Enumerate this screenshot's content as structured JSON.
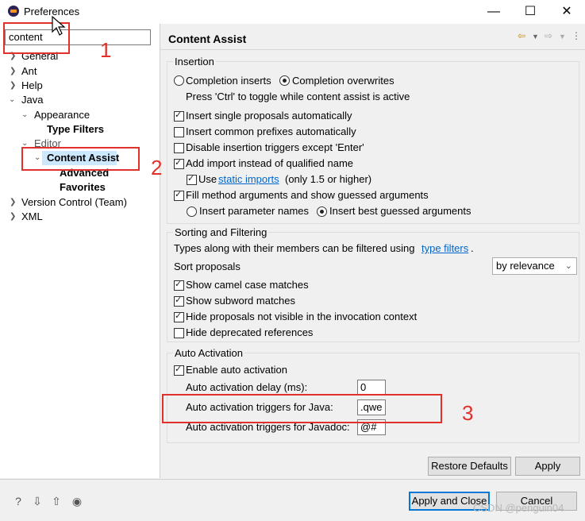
{
  "window": {
    "title": "Preferences",
    "minimize": "—",
    "maximize": "☐",
    "close": "✕"
  },
  "filter": {
    "value": "content"
  },
  "tree": {
    "general": "General",
    "ant": "Ant",
    "help": "Help",
    "java": "Java",
    "appearance": "Appearance",
    "type_filters": "Type Filters",
    "editor": "Editor",
    "content_assist": "Content Assist",
    "advanced": "Advanced",
    "favorites": "Favorites",
    "version_control": "Version Control (Team)",
    "xml": "XML"
  },
  "page": {
    "title": "Content Assist"
  },
  "insertion": {
    "title": "Insertion",
    "completion_inserts": "Completion inserts",
    "completion_overwrites": "Completion overwrites",
    "toggle_hint": "Press 'Ctrl' to toggle while content assist is active",
    "insert_single": "Insert single proposals automatically",
    "insert_common": "Insert common prefixes automatically",
    "disable_triggers": "Disable insertion triggers except 'Enter'",
    "add_import": "Add import instead of qualified name",
    "use": "Use",
    "static_imports": "static imports",
    "only_15": "(only 1.5 or higher)",
    "fill_args": "Fill method arguments and show guessed arguments",
    "insert_param": "Insert parameter names",
    "insert_best": "Insert best guessed arguments"
  },
  "sorting": {
    "title": "Sorting and Filtering",
    "types_text": "Types along with their members can be filtered using",
    "type_filters_link": "type filters",
    "period": ".",
    "sort_label": "Sort proposals",
    "sort_value": "by relevance",
    "camel": "Show camel case matches",
    "subword": "Show subword matches",
    "hide_not_visible": "Hide proposals not visible in the invocation context",
    "hide_deprecated": "Hide deprecated references"
  },
  "auto": {
    "title": "Auto Activation",
    "enable": "Enable auto activation",
    "delay_label": "Auto activation delay (ms):",
    "delay_value": "0",
    "java_label": "Auto activation triggers for Java:",
    "java_value": ".qwe",
    "javadoc_label": "Auto activation triggers for Javadoc:",
    "javadoc_value": "@#"
  },
  "buttons": {
    "restore": "Restore Defaults",
    "apply": "Apply",
    "apply_close": "Apply and Close",
    "cancel": "Cancel"
  },
  "annotations": {
    "n1": "1",
    "n2": "2",
    "n3": "3"
  },
  "watermark": "CSDN @penguin04",
  "colors": {
    "highlight": "#e0312b",
    "selection": "#cce8ff",
    "link": "#0066cc"
  }
}
